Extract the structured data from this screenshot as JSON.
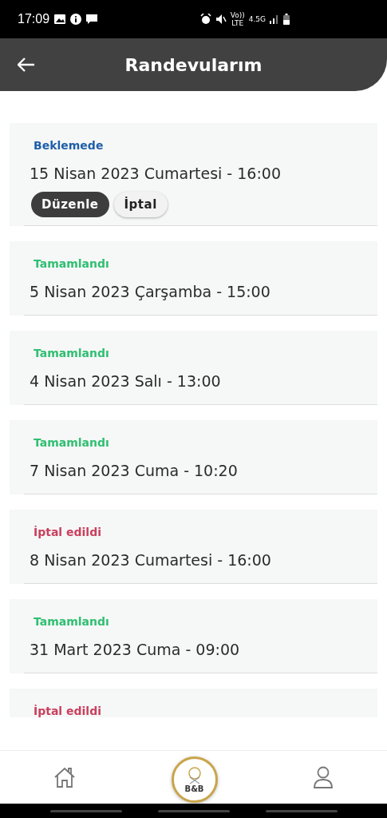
{
  "status_bar": {
    "time": "17:09",
    "volte": "Vo))",
    "lte": "LTE",
    "network": "4.5G"
  },
  "header": {
    "title": "Randevularım"
  },
  "appointments": [
    {
      "status": "Beklemede",
      "kind": "pending",
      "date": "15 Nisan 2023 Cumartesi - 16:00",
      "actions": [
        {
          "label": "Düzenle",
          "kind": "primary"
        },
        {
          "label": "İptal",
          "kind": "secondary"
        }
      ]
    },
    {
      "status": "Tamamlandı",
      "kind": "done",
      "date": "5 Nisan 2023 Çarşamba - 15:00"
    },
    {
      "status": "Tamamlandı",
      "kind": "done",
      "date": "4 Nisan 2023 Salı - 13:00"
    },
    {
      "status": "Tamamlandı",
      "kind": "done",
      "date": "7 Nisan 2023 Cuma - 10:20"
    },
    {
      "status": "İptal edildi",
      "kind": "cancelled",
      "date": "8 Nisan 2023 Cumartesi - 16:00"
    },
    {
      "status": "Tamamlandı",
      "kind": "done",
      "date": "31 Mart 2023 Cuma - 09:00"
    },
    {
      "status": "İptal edildi",
      "kind": "cancelled"
    }
  ],
  "bottom_nav": {
    "logo": "B&B"
  }
}
